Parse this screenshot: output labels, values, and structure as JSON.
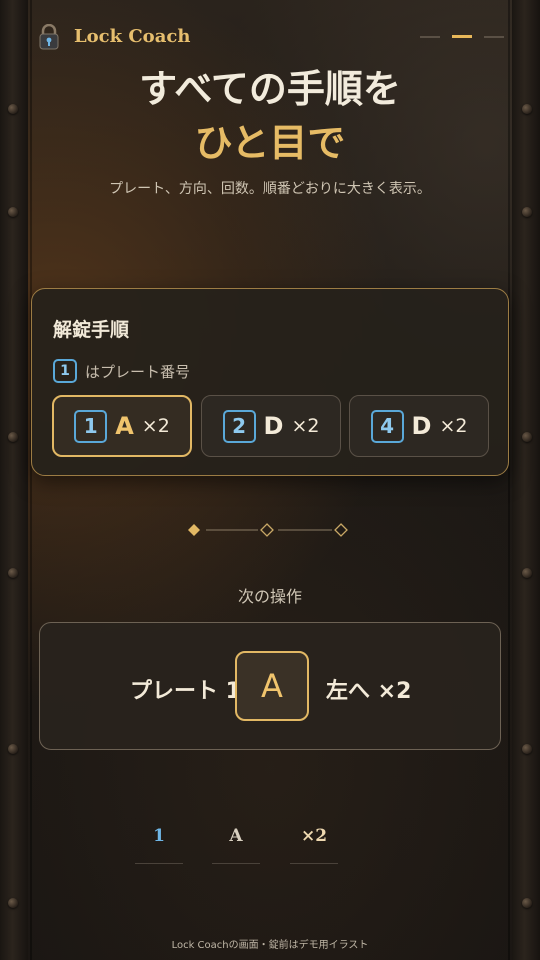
{
  "app": {
    "name": "Lock Coach",
    "progress_total": 3,
    "progress_current": 2
  },
  "hero": {
    "title_line1": "すべての手順を",
    "title_line2": "ひと目で",
    "subtitle": "プレート、方向、回数。順番どおりに大きく表示。"
  },
  "steps_card": {
    "title": "解錠手順",
    "legend_number": "1",
    "legend_text": "はプレート番号",
    "steps": [
      {
        "plate": "1",
        "letter": "A",
        "count": "×2",
        "active": true
      },
      {
        "plate": "2",
        "letter": "D",
        "count": "×2",
        "active": false
      },
      {
        "plate": "4",
        "letter": "D",
        "count": "×2",
        "active": false
      }
    ]
  },
  "next": {
    "label": "次の操作",
    "plate_text": "プレート 1",
    "letter": "A",
    "direction_text": "左へ ×2"
  },
  "tokens": [
    "1",
    "A",
    "×2"
  ],
  "footer": "Lock Coachの画面・錠前はデモ用イラスト",
  "colors": {
    "accent_gold": "#e6bb65",
    "plate_blue": "#5aa8d8",
    "background": "#1c1814"
  },
  "icons": {
    "brand": "padlock-icon"
  }
}
